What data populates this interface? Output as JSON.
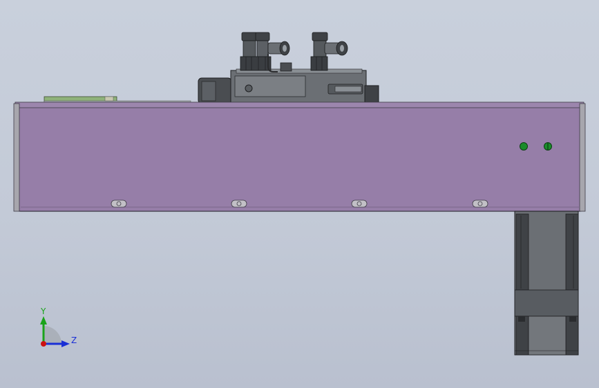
{
  "viewport": {
    "background_top": "#c9d0dc",
    "background_bottom": "#b9c0cf"
  },
  "model": {
    "body_color": "#967ea8",
    "body_edge_color": "#4a4a55",
    "component_dark": "#3f4246",
    "component_mid": "#6b6f74",
    "component_light": "#9aa0a6",
    "indicator_color": "#1a8c2a",
    "board_color": "#8fb27a"
  },
  "triad": {
    "y_label": "Y",
    "z_label": "Z",
    "y_color": "#1aa31a",
    "z_color": "#1a2fd6",
    "x_color": "#cc1111"
  }
}
